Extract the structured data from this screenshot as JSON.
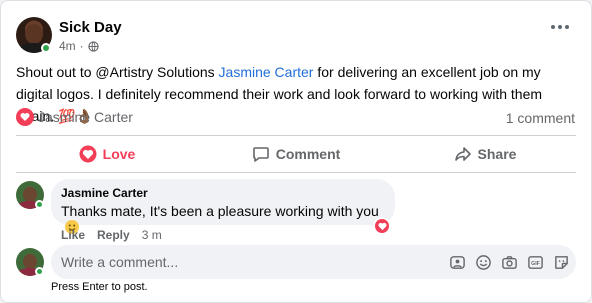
{
  "post": {
    "author": "Sick Day",
    "time": "4m",
    "text_prefix": "Shout out to @Artistry Solutions ",
    "mention": "Jasmine Carter",
    "text_suffix": " for delivering an excellent job on my digital logos. I definitely recommend their work and look forward to working with them again. 💯👌🏾",
    "reactor": "Jasmine Carter",
    "comment_count": "1 comment"
  },
  "actions": {
    "love": "Love",
    "comment": "Comment",
    "share": "Share"
  },
  "comment": {
    "author": "Jasmine Carter",
    "text": "Thanks mate, It's been a pleasure working with you",
    "like": "Like",
    "reply": "Reply",
    "time": "3 m"
  },
  "composer": {
    "placeholder": "Write a comment...",
    "hint": "Press Enter to post."
  },
  "icons": [
    "more-options-icon",
    "globe-icon",
    "heart-icon",
    "comment-icon",
    "share-icon",
    "emoji-icon",
    "camera-icon",
    "gif-icon",
    "sticker-icon",
    "avatar-sticker-icon"
  ],
  "colors": {
    "love": "#f33e58",
    "link": "#216fdb",
    "online": "#31a24c",
    "muted": "#65676b"
  }
}
